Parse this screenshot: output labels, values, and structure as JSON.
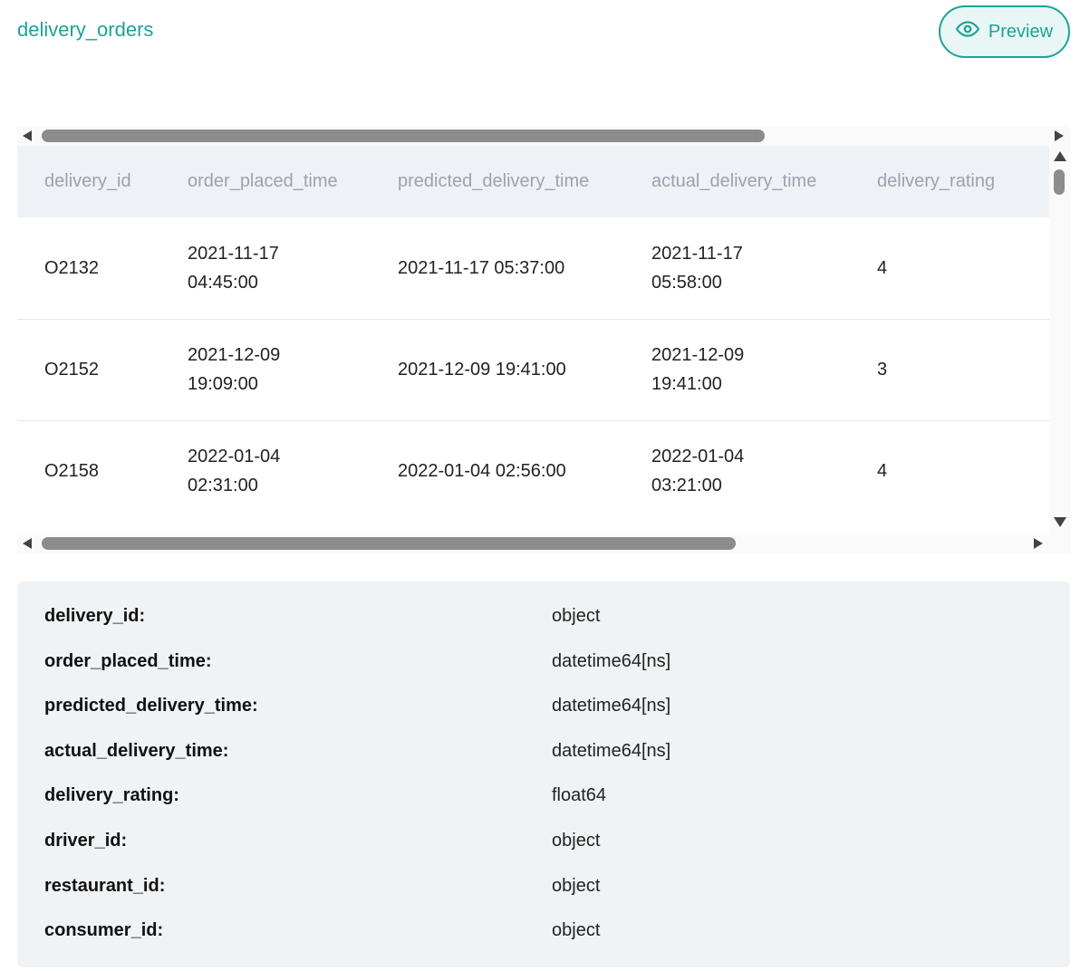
{
  "header": {
    "dataset_name": "delivery_orders",
    "preview_label": "Preview",
    "preview_icon": "eye-icon",
    "accent_color": "#1aa39a"
  },
  "table": {
    "columns": [
      "delivery_id",
      "order_placed_time",
      "predicted_delivery_time",
      "actual_delivery_time",
      "delivery_rating"
    ],
    "rows": [
      {
        "delivery_id": "O2132",
        "order_placed_time": {
          "date": "2021-11-17",
          "time": "04:45:00"
        },
        "predicted_delivery_time": "2021-11-17 05:37:00",
        "actual_delivery_time": {
          "date": "2021-11-17",
          "time": "05:58:00"
        },
        "delivery_rating": "4"
      },
      {
        "delivery_id": "O2152",
        "order_placed_time": {
          "date": "2021-12-09",
          "time": "19:09:00"
        },
        "predicted_delivery_time": "2021-12-09 19:41:00",
        "actual_delivery_time": {
          "date": "2021-12-09",
          "time": "19:41:00"
        },
        "delivery_rating": "3"
      },
      {
        "delivery_id": "O2158",
        "order_placed_time": {
          "date": "2022-01-04",
          "time": "02:31:00"
        },
        "predicted_delivery_time": "2022-01-04 02:56:00",
        "actual_delivery_time": {
          "date": "2022-01-04",
          "time": "03:21:00"
        },
        "delivery_rating": "4"
      }
    ]
  },
  "schema": [
    {
      "name": "delivery_id:",
      "dtype": "object"
    },
    {
      "name": "order_placed_time:",
      "dtype": "datetime64[ns]"
    },
    {
      "name": "predicted_delivery_time:",
      "dtype": "datetime64[ns]"
    },
    {
      "name": "actual_delivery_time:",
      "dtype": "datetime64[ns]"
    },
    {
      "name": "delivery_rating:",
      "dtype": "float64"
    },
    {
      "name": "driver_id:",
      "dtype": "object"
    },
    {
      "name": "restaurant_id:",
      "dtype": "object"
    },
    {
      "name": "consumer_id:",
      "dtype": "object"
    }
  ]
}
